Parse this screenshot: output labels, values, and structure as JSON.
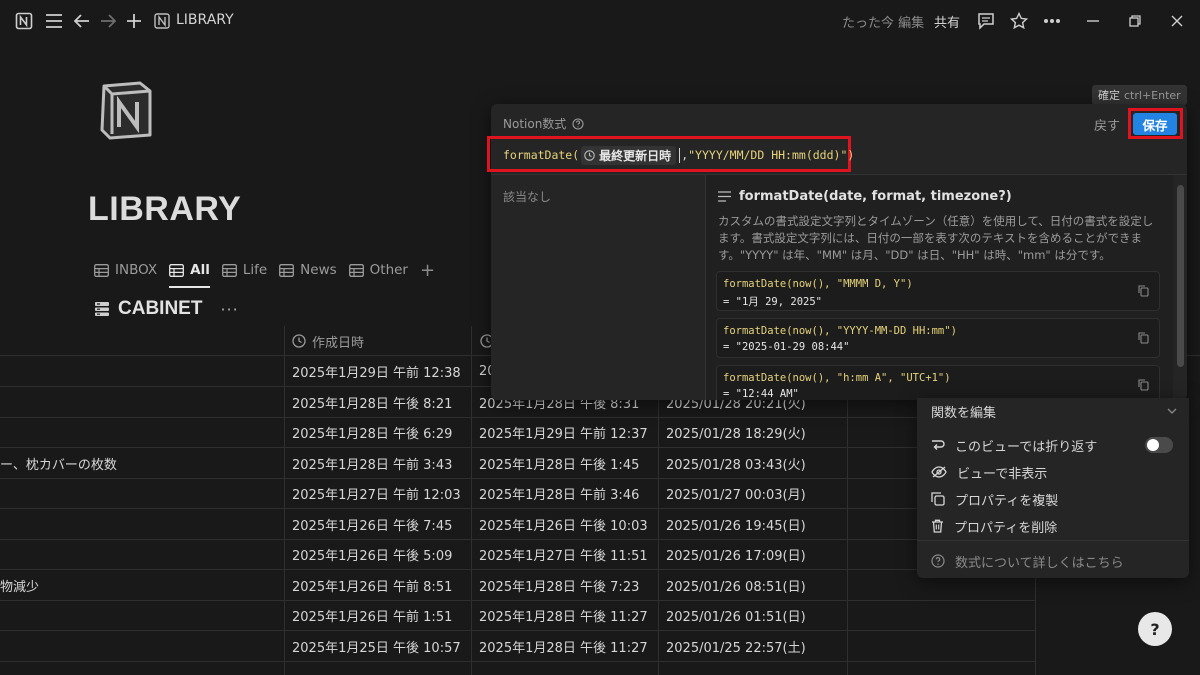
{
  "topbar": {
    "breadcrumb": "LIBRARY",
    "edited": "たった今 編集",
    "share": "共有"
  },
  "page": {
    "title": "LIBRARY"
  },
  "views": [
    {
      "label": "INBOX",
      "active": false
    },
    {
      "label": "All",
      "active": true
    },
    {
      "label": "Life",
      "active": false
    },
    {
      "label": "News",
      "active": false
    },
    {
      "label": "Other",
      "active": false
    }
  ],
  "database": {
    "title": "CABINET",
    "dots": "···"
  },
  "table": {
    "columns": [
      "作成日時"
    ],
    "rows": [
      {
        "name": "",
        "created": "2025年1月29日 午前 12:38",
        "edited": "20",
        "formula": ""
      },
      {
        "name": "",
        "created": "2025年1月28日 午後 8:21",
        "edited": "2025年1月28日 午後 8:31",
        "formula": "2025/01/28 20:21(火)"
      },
      {
        "name": "",
        "created": "2025年1月28日 午後 6:29",
        "edited": "2025年1月29日 午前 12:37",
        "formula": "2025/01/28 18:29(火)"
      },
      {
        "name": "ー、枕カバーの枚数",
        "created": "2025年1月28日 午前 3:43",
        "edited": "2025年1月28日 午後 1:45",
        "formula": "2025/01/28 03:43(火)"
      },
      {
        "name": "",
        "created": "2025年1月27日 午前 12:03",
        "edited": "2025年1月28日 午前 3:46",
        "formula": "2025/01/27 00:03(月)"
      },
      {
        "name": "",
        "created": "2025年1月26日 午後 7:45",
        "edited": "2025年1月26日 午後 10:03",
        "formula": "2025/01/26 19:45(日)"
      },
      {
        "name": "",
        "created": "2025年1月26日 午後 5:09",
        "edited": "2025年1月27日 午後 11:51",
        "formula": "2025/01/26 17:09(日)"
      },
      {
        "name": "物減少",
        "created": "2025年1月26日 午前 8:51",
        "edited": "2025年1月28日 午後 7:23",
        "formula": "2025/01/26 08:51(日)"
      },
      {
        "name": "",
        "created": "2025年1月26日 午前 1:51",
        "edited": "2025年1月28日 午後 11:27",
        "formula": "2025/01/26 01:51(日)"
      },
      {
        "name": "",
        "created": "2025年1月25日 午後 10:57",
        "edited": "2025年1月28日 午後 11:27",
        "formula": "2025/01/25 22:57(土)"
      }
    ]
  },
  "formula_popup": {
    "label": "Notion数式",
    "back": "戻す",
    "save": "保存",
    "formula": {
      "func": "formatDate(",
      "property": "最終更新日時",
      "comma": ",",
      "format_string": " \"YYYY/MM/DD HH:mm(ddd)\")"
    },
    "no_result": "該当なし",
    "detail_title": "formatDate(date, format, timezone?)",
    "detail_desc": "カスタムの書式設定文字列とタイムゾーン（任意）を使用して、日付の書式を設定します。書式設定文字列には、日付の一部を表す次のテキストを含めることができます。\"YYYY\" は年、\"MM\" は月、\"DD\" は日、\"HH\" は時、\"mm\" は分です。",
    "examples": [
      {
        "code": "formatDate(now(), \"MMMM D, Y\")",
        "result": "= \"1月 29, 2025\""
      },
      {
        "code": "formatDate(now(), \"YYYY-MM-DD HH:mm\")",
        "result": "= \"2025-01-29 08:44\""
      },
      {
        "code": "formatDate(now(), \"h:mm A\", \"UTC+1\")",
        "result": "= \"12:44 AM\""
      }
    ]
  },
  "tooltip": {
    "label": "確定",
    "shortcut": "ctrl+Enter"
  },
  "menu": {
    "edit_function": "関数を編集",
    "wrap": "このビューでは折り返す",
    "hide": "ビューで非表示",
    "duplicate": "プロパティを複製",
    "delete": "プロパティを削除",
    "learn": "数式について詳しくはこちら"
  },
  "help": {
    "label": "?"
  }
}
